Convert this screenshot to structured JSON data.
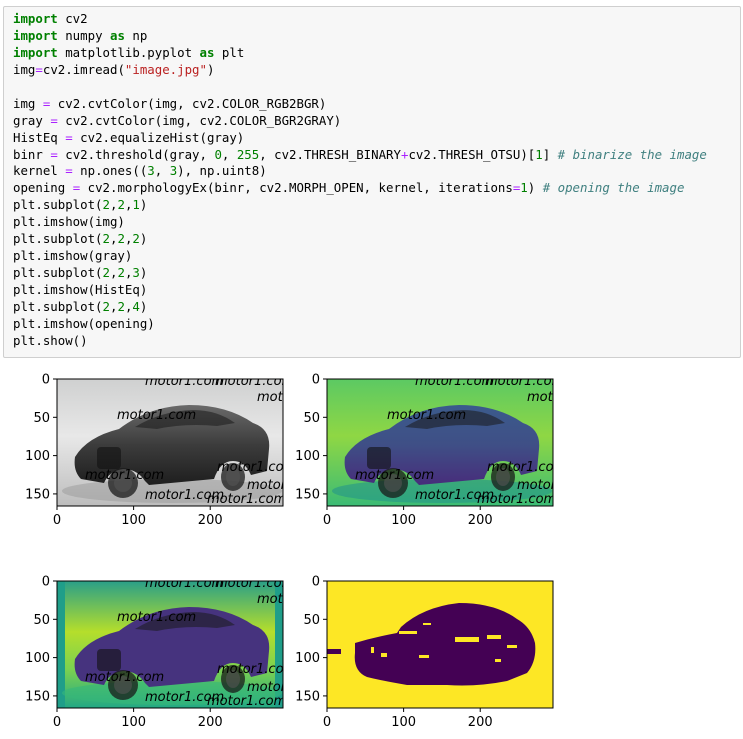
{
  "code_cell": {
    "lines": [
      [
        {
          "t": "import",
          "c": "kw"
        },
        {
          "t": " cv2"
        }
      ],
      [
        {
          "t": "import",
          "c": "kw"
        },
        {
          "t": " numpy "
        },
        {
          "t": "as",
          "c": "kw"
        },
        {
          "t": " np"
        }
      ],
      [
        {
          "t": "import",
          "c": "kw"
        },
        {
          "t": " matplotlib.pyplot "
        },
        {
          "t": "as",
          "c": "kw"
        },
        {
          "t": " plt"
        }
      ],
      [
        {
          "t": "img"
        },
        {
          "t": "=",
          "c": "op"
        },
        {
          "t": "cv2.imread("
        },
        {
          "t": "\"image.jpg\"",
          "c": "str"
        },
        {
          "t": ")"
        }
      ],
      [],
      [
        {
          "t": "img "
        },
        {
          "t": "=",
          "c": "op"
        },
        {
          "t": " cv2.cvtColor(img, cv2.COLOR_RGB2BGR)"
        }
      ],
      [
        {
          "t": "gray "
        },
        {
          "t": "=",
          "c": "op"
        },
        {
          "t": " cv2.cvtColor(img, cv2.COLOR_BGR2GRAY)"
        }
      ],
      [
        {
          "t": "HistEq "
        },
        {
          "t": "=",
          "c": "op"
        },
        {
          "t": " cv2.equalizeHist(gray)"
        }
      ],
      [
        {
          "t": "binr "
        },
        {
          "t": "=",
          "c": "op"
        },
        {
          "t": " cv2.threshold(gray, "
        },
        {
          "t": "0",
          "c": "num"
        },
        {
          "t": ", "
        },
        {
          "t": "255",
          "c": "num"
        },
        {
          "t": ", cv2.THRESH_BINARY"
        },
        {
          "t": "+",
          "c": "op"
        },
        {
          "t": "cv2.THRESH_OTSU)["
        },
        {
          "t": "1",
          "c": "num"
        },
        {
          "t": "] "
        },
        {
          "t": "# binarize the image",
          "c": "cmt"
        }
      ],
      [
        {
          "t": "kernel "
        },
        {
          "t": "=",
          "c": "op"
        },
        {
          "t": " np.ones(("
        },
        {
          "t": "3",
          "c": "num"
        },
        {
          "t": ", "
        },
        {
          "t": "3",
          "c": "num"
        },
        {
          "t": "), np.uint8)"
        }
      ],
      [
        {
          "t": "opening "
        },
        {
          "t": "=",
          "c": "op"
        },
        {
          "t": " cv2.morphologyEx(binr, cv2.MORPH_OPEN, kernel, iterations"
        },
        {
          "t": "=",
          "c": "op"
        },
        {
          "t": "1",
          "c": "num"
        },
        {
          "t": ") "
        },
        {
          "t": "# opening the image",
          "c": "cmt"
        }
      ],
      [
        {
          "t": "plt.subplot("
        },
        {
          "t": "2",
          "c": "num"
        },
        {
          "t": ","
        },
        {
          "t": "2",
          "c": "num"
        },
        {
          "t": ","
        },
        {
          "t": "1",
          "c": "num"
        },
        {
          "t": ")"
        }
      ],
      [
        {
          "t": "plt.imshow(img)"
        }
      ],
      [
        {
          "t": "plt.subplot("
        },
        {
          "t": "2",
          "c": "num"
        },
        {
          "t": ","
        },
        {
          "t": "2",
          "c": "num"
        },
        {
          "t": ","
        },
        {
          "t": "2",
          "c": "num"
        },
        {
          "t": ")"
        }
      ],
      [
        {
          "t": "plt.imshow(gray)"
        }
      ],
      [
        {
          "t": "plt.subplot("
        },
        {
          "t": "2",
          "c": "num"
        },
        {
          "t": ","
        },
        {
          "t": "2",
          "c": "num"
        },
        {
          "t": ","
        },
        {
          "t": "3",
          "c": "num"
        },
        {
          "t": ")"
        }
      ],
      [
        {
          "t": "plt.imshow(HistEq)"
        }
      ],
      [
        {
          "t": "plt.subplot("
        },
        {
          "t": "2",
          "c": "num"
        },
        {
          "t": ","
        },
        {
          "t": "2",
          "c": "num"
        },
        {
          "t": ","
        },
        {
          "t": "4",
          "c": "num"
        },
        {
          "t": ")"
        }
      ],
      [
        {
          "t": "plt.imshow(opening)"
        }
      ],
      [
        {
          "t": "plt.show()"
        }
      ]
    ]
  },
  "colors": {
    "cell_bg": "#f7f7f7",
    "keyword": "#008000",
    "string": "#ba2121",
    "number": "#008000",
    "operator": "#aa22ff",
    "comment": "#408080",
    "viridis_yellow": "#fde725",
    "viridis_purple": "#440154"
  },
  "plots": [
    {
      "id": "img",
      "kind": "photo-bw",
      "yticks": [
        "0",
        "50",
        "100",
        "150"
      ],
      "xticks": [
        "0",
        "100",
        "200"
      ]
    },
    {
      "id": "gray",
      "kind": "viridis-gray",
      "yticks": [
        "0",
        "50",
        "100",
        "150"
      ],
      "xticks": [
        "0",
        "100",
        "200"
      ]
    },
    {
      "id": "HistEq",
      "kind": "viridis-histeq",
      "yticks": [
        "0",
        "50",
        "100",
        "150"
      ],
      "xticks": [
        "0",
        "100",
        "200"
      ]
    },
    {
      "id": "opening",
      "kind": "binary",
      "yticks": [
        "0",
        "50",
        "100",
        "150"
      ],
      "xticks": [
        "0",
        "100",
        "200"
      ]
    }
  ],
  "watermark": "motor1.com"
}
